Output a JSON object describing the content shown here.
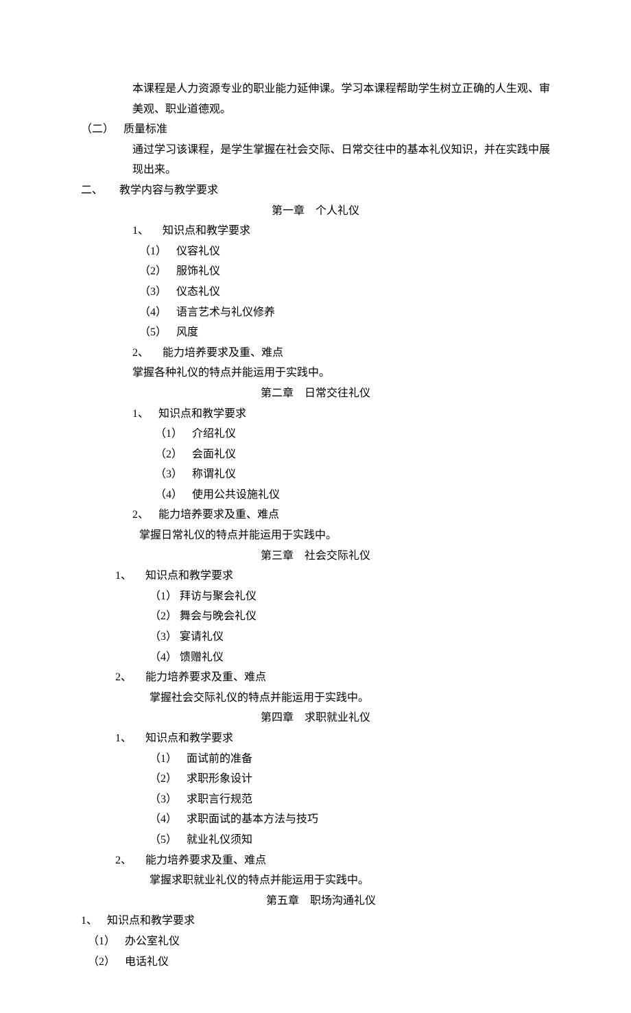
{
  "intro_para": "本课程是人力资源专业的职业能力延伸课。学习本课程帮助学生树立正确的人生观、审美观、职业道德观。",
  "s1_2": {
    "label": "（二）",
    "title": "质量标准",
    "body": "通过学习该课程，是学生掌握在社会交际、日常交往中的基本礼仪知识，并在实践中展现出来。"
  },
  "s2": {
    "label": "二、",
    "title": "教学内容与教学要求"
  },
  "chapters": {
    "ch1": {
      "title": "第一章　个人礼仪",
      "k_label": "1、",
      "k_title": "知识点和教学要求",
      "items": {
        "i1": {
          "label": "（1）",
          "text": "仪容礼仪"
        },
        "i2": {
          "label": "（2）",
          "text": "服饰礼仪"
        },
        "i3": {
          "label": "（3）",
          "text": "仪态礼仪"
        },
        "i4": {
          "label": "（4）",
          "text": "语言艺术与礼仪修养"
        },
        "i5": {
          "label": "（5）",
          "text": "风度"
        }
      },
      "a_label": "2、",
      "a_title": "能力培养要求及重、难点",
      "a_body": "掌握各种礼仪的特点并能运用于实践中。"
    },
    "ch2": {
      "title": "第二章　日常交往礼仪",
      "k_label": "1、",
      "k_title": "知识点和教学要求",
      "items": {
        "i1": {
          "label": "（1）",
          "text": "介绍礼仪"
        },
        "i2": {
          "label": "（2）",
          "text": "会面礼仪"
        },
        "i3": {
          "label": "（3）",
          "text": "称谓礼仪"
        },
        "i4": {
          "label": "（4）",
          "text": "使用公共设施礼仪"
        }
      },
      "a_label": "2、",
      "a_title": "能力培养要求及重、难点",
      "a_body": "掌握日常礼仪的特点并能运用于实践中。"
    },
    "ch3": {
      "title": "第三章　社会交际礼仪",
      "k_label": "1、",
      "k_title": "知识点和教学要求",
      "items": {
        "i1": {
          "label": "（1）",
          "text": "拜访与聚会礼仪"
        },
        "i2": {
          "label": "（2）",
          "text": "舞会与晚会礼仪"
        },
        "i3": {
          "label": "（3）",
          "text": "宴请礼仪"
        },
        "i4": {
          "label": "（4）",
          "text": "馈赠礼仪"
        }
      },
      "a_label": "2、",
      "a_title": "能力培养要求及重、难点",
      "a_body": "掌握社会交际礼仪的特点并能运用于实践中。"
    },
    "ch4": {
      "title": "第四章　求职就业礼仪",
      "k_label": "1、",
      "k_title": "知识点和教学要求",
      "items": {
        "i1": {
          "label": "（1）",
          "text": "面试前的准备"
        },
        "i2": {
          "label": "（2）",
          "text": "求职形象设计"
        },
        "i3": {
          "label": "（3）",
          "text": "求职言行规范"
        },
        "i4": {
          "label": "（4）",
          "text": "求职面试的基本方法与技巧"
        },
        "i5": {
          "label": "（5）",
          "text": "就业礼仪须知"
        }
      },
      "a_label": "2、",
      "a_title": "能力培养要求及重、难点",
      "a_body": "掌握求职就业礼仪的特点并能运用于实践中。"
    },
    "ch5": {
      "title": "第五章　职场沟通礼仪",
      "k_label": "1、",
      "k_title": "知识点和教学要求",
      "items": {
        "i1": {
          "label": "（1）",
          "text": "办公室礼仪"
        },
        "i2": {
          "label": "（2）",
          "text": "电话礼仪"
        }
      }
    }
  }
}
